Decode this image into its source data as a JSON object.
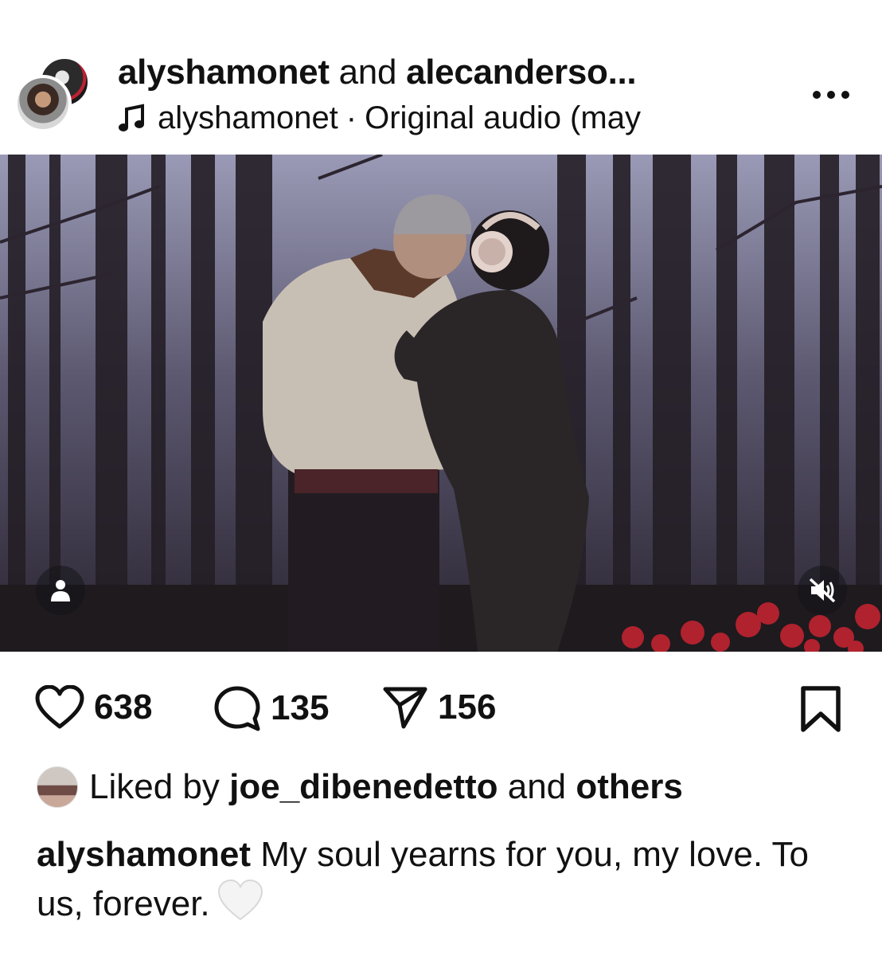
{
  "header": {
    "title_user1": "alyshamonet",
    "title_and": "and",
    "title_user2": "alecanderso...",
    "audio_user": "alyshamonet",
    "audio_sep": "·",
    "audio_label": "Original audio (may",
    "more_label": "..."
  },
  "icons": {
    "audio": "music-note-icon",
    "more": "more-options-icon",
    "tag": "tagged-people-icon",
    "mute": "muted-speaker-icon",
    "like": "heart-icon",
    "comment": "comment-icon",
    "share": "send-icon",
    "save": "bookmark-icon",
    "caption_emoji": "white-heart-emoji"
  },
  "stats": {
    "likes": "638",
    "comments": "135",
    "shares": "156"
  },
  "liked_by": {
    "prefix": "Liked by",
    "user": "joe_dibenedetto",
    "and": "and",
    "others": "others"
  },
  "caption": {
    "user": "alyshamonet",
    "text": "My soul yearns for you, my love. To us, forever."
  },
  "colors": {
    "text": "#111111",
    "background": "#ffffff",
    "media_sky": "#8a8aa6",
    "flowers": "#b0222e"
  }
}
